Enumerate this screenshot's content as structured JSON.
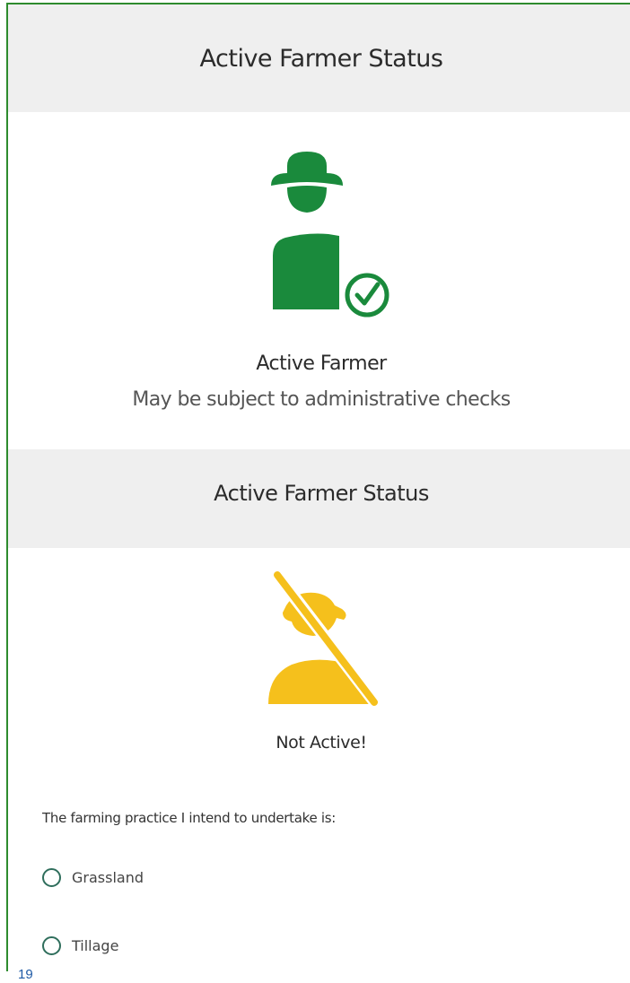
{
  "sections": {
    "active": {
      "header": "Active Farmer Status",
      "status_title": "Active Farmer",
      "status_subtitle": "May be subject to administrative checks",
      "icon": "farmer-check-icon",
      "color": "#1a8a3c"
    },
    "inactive": {
      "header": "Active Farmer Status",
      "status_title": "Not Active!",
      "icon": "farmer-crossed-icon",
      "color": "#f5c01c"
    }
  },
  "question": {
    "text": "The farming practice I intend to undertake is:",
    "options": [
      {
        "label": "Grassland",
        "selected": false
      },
      {
        "label": "Tillage",
        "selected": false
      }
    ]
  },
  "page_number": "19",
  "colors": {
    "frame_border": "#2e8b2e",
    "header_bg": "#efefef",
    "radio": "#2f6e5c",
    "page_number": "#1f5aa6"
  }
}
